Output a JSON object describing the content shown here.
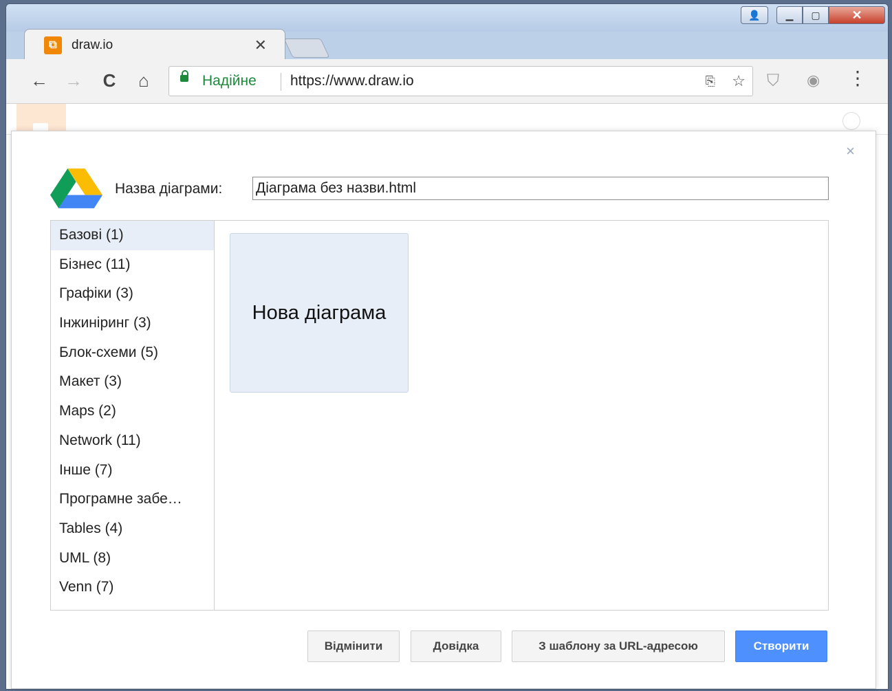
{
  "browser": {
    "tab_title": "draw.io",
    "tab_close": "✕",
    "secure_label": "Надійне",
    "url": "https://www.draw.io",
    "nav": {
      "back": "←",
      "forward": "→",
      "reload": "C",
      "home": "⌂"
    },
    "star": "☆",
    "menu": "⋮"
  },
  "dialog": {
    "close": "×",
    "name_label": "Назва діаграми:",
    "name_value": "Діаграма без назви.html",
    "categories": [
      "Базові (1)",
      "Бізнес (11)",
      "Графіки (3)",
      "Інжиніринг (3)",
      "Блок-схеми (5)",
      "Макет (3)",
      "Maps (2)",
      "Network (11)",
      "Інше (7)",
      "Програмне забе…",
      "Tables (4)",
      "UML (8)",
      "Venn (7)"
    ],
    "template_label": "Нова діаграма",
    "buttons": {
      "cancel": "Відмінити",
      "help": "Довідка",
      "from_url": "З шаблону за URL-адресою",
      "create": "Створити"
    }
  },
  "colors": {
    "primary": "#4d90fe",
    "selected_bg": "#e8eef7",
    "secure": "#1b8a3a",
    "favicon": "#f08705"
  }
}
